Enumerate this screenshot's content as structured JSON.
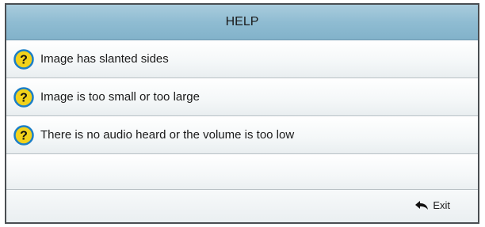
{
  "header": {
    "title": "HELP"
  },
  "help_items": [
    {
      "label": "Image has slanted sides",
      "icon": "question-circle-icon"
    },
    {
      "label": "Image is too small or too large",
      "icon": "question-circle-icon"
    },
    {
      "label": "There is no audio heard or the volume is too low",
      "icon": "question-circle-icon"
    }
  ],
  "footer": {
    "exit_label": "Exit",
    "exit_icon": "return-arrow-icon"
  },
  "colors": {
    "header_bg": "#8fbcd2",
    "icon_ring": "#1c7fc6",
    "icon_fill": "#f2d21b"
  }
}
